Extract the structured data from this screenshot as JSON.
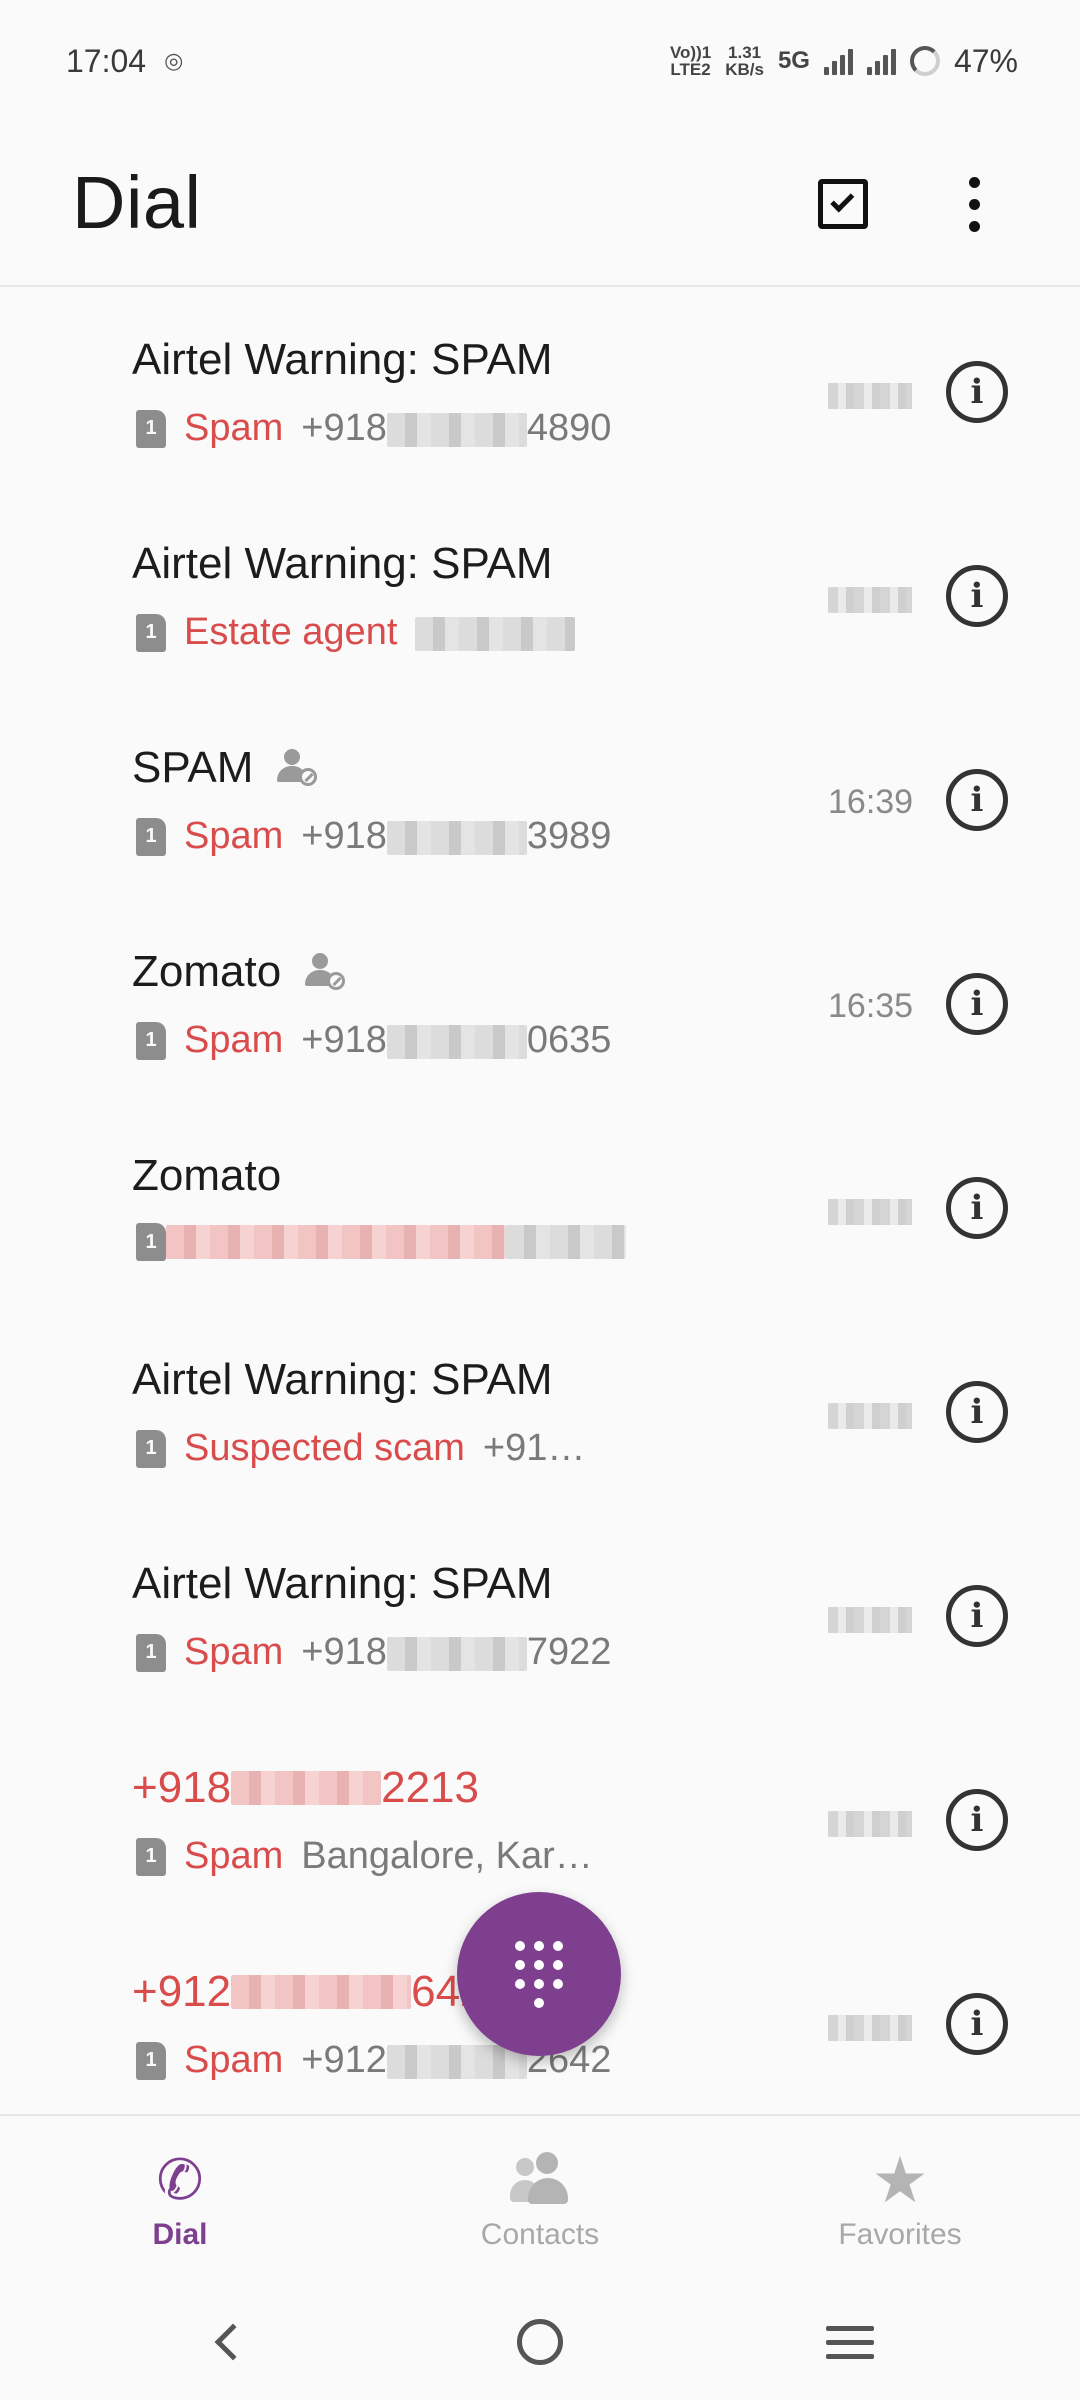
{
  "status_bar": {
    "time": "17:04",
    "volte_top": "Vo))1",
    "volte_bottom": "LTE2",
    "speed_value": "1.31",
    "speed_unit": "KB/s",
    "network": "5G",
    "battery": "47%",
    "icons": [
      "data-saver-icon",
      "signal-icon",
      "battery-ring-icon"
    ]
  },
  "header": {
    "title": "Dial",
    "actions": [
      "select-checkbox-icon",
      "more-options-icon"
    ]
  },
  "calls": [
    {
      "name": "Airtel Warning: SPAM",
      "name_red": false,
      "blocked": false,
      "tag": "Spam",
      "num_prefix": "+918",
      "num_suffix": "4890",
      "time": ""
    },
    {
      "name": "Airtel Warning: SPAM",
      "name_red": false,
      "blocked": false,
      "tag": "Estate agent",
      "num_prefix": "",
      "num_suffix": "",
      "time": ""
    },
    {
      "name": "SPAM",
      "name_red": false,
      "blocked": true,
      "tag": "Spam",
      "num_prefix": "+918",
      "num_suffix": "3989",
      "time": "16:39"
    },
    {
      "name": "Zomato",
      "name_red": false,
      "blocked": true,
      "tag": "Spam",
      "num_prefix": "+918",
      "num_suffix": "0635",
      "time": "16:35"
    },
    {
      "name": "Zomato",
      "name_red": false,
      "blocked": false,
      "tag": "",
      "num_prefix": "",
      "num_suffix": "",
      "time": ""
    },
    {
      "name": "Airtel Warning: SPAM",
      "name_red": false,
      "blocked": false,
      "tag": "Suspected scam",
      "num_prefix": "+91…",
      "num_suffix": "",
      "time": ""
    },
    {
      "name": "Airtel Warning: SPAM",
      "name_red": false,
      "blocked": false,
      "tag": "Spam",
      "num_prefix": "+918",
      "num_suffix": "7922",
      "time": ""
    },
    {
      "name": "+918",
      "name_suffix": "2213",
      "name_red": true,
      "blocked": false,
      "tag": "Spam",
      "num_prefix": "Bangalore, Kar…",
      "num_suffix": "",
      "time": ""
    },
    {
      "name": "+912",
      "name_suffix": "642",
      "name_red": true,
      "blocked": false,
      "tag": "Spam",
      "num_prefix": "+912",
      "num_suffix": "2642",
      "time": ""
    }
  ],
  "fab": {
    "icon": "dialpad-icon"
  },
  "bottom_nav": {
    "items": [
      {
        "label": "Dial",
        "icon": "phone-icon",
        "active": true
      },
      {
        "label": "Contacts",
        "icon": "contacts-icon",
        "active": false
      },
      {
        "label": "Favorites",
        "icon": "star-icon",
        "active": false
      }
    ]
  },
  "system_nav": [
    "back-icon",
    "home-icon",
    "recents-icon"
  ],
  "colors": {
    "accent": "#7e3f8f",
    "spam_red": "#d94c4c",
    "text": "#1c1c1c",
    "muted": "#7a7a7a"
  }
}
